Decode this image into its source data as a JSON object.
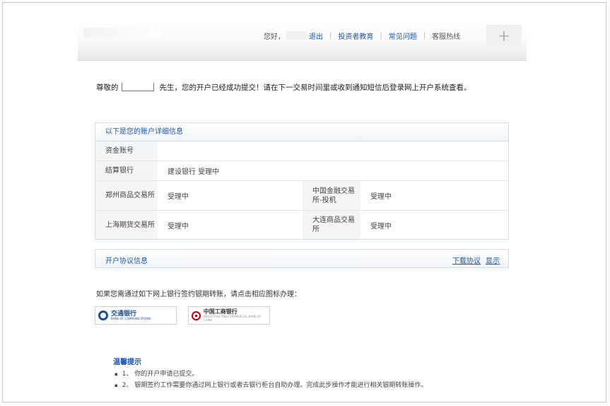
{
  "header": {
    "greeting": "您好，",
    "links": [
      "退出",
      "投资者教育",
      "常见问题"
    ],
    "hotline": "客服热线",
    "plus_symbol": "+"
  },
  "message": {
    "prefix": "尊敬的",
    "suffix": "先生，您的开户已经成功提交！请在下一交易时间里或收到通知短信后登录网上开户系统查看。"
  },
  "account_panel": {
    "title": "以下是您的账户详细信息",
    "rows": [
      {
        "label": "资金账号",
        "value": ""
      },
      {
        "label": "结算银行",
        "value": "建设银行 受理中"
      },
      {
        "label": "郑州商品交易所",
        "value": "受理中",
        "label2": "中国金融交易所-投机",
        "value2": "受理中"
      },
      {
        "label": "上海期货交易所",
        "value": "受理中",
        "label2": "大连商品交易所",
        "value2": "受理中"
      }
    ]
  },
  "agreement": {
    "title": "开户协议信息",
    "download": "下载协议",
    "show": "显示"
  },
  "bank_section": {
    "tip": "如果您需通过如下网上银行签约银期转账，请点击相应图标办理：",
    "banks": [
      {
        "cn": "交通银行",
        "en": "BANK OF COMMUNICATIONS",
        "color": "#1c4f9c"
      },
      {
        "cn": "中国工商银行",
        "en": "INDUSTRIAL AND COMMERCIAL BANK OF CHINA",
        "color": "#c7000b"
      }
    ]
  },
  "tips": {
    "title": "温馨提示",
    "items": [
      "1、 你的开户申请已提交。",
      "2、 银期签约工作需要你通过网上银行或者去银行柜台自助办理。完成此步操作才能进行相关银期转账操作。"
    ]
  },
  "colors": {
    "link": "#1a55b0"
  }
}
